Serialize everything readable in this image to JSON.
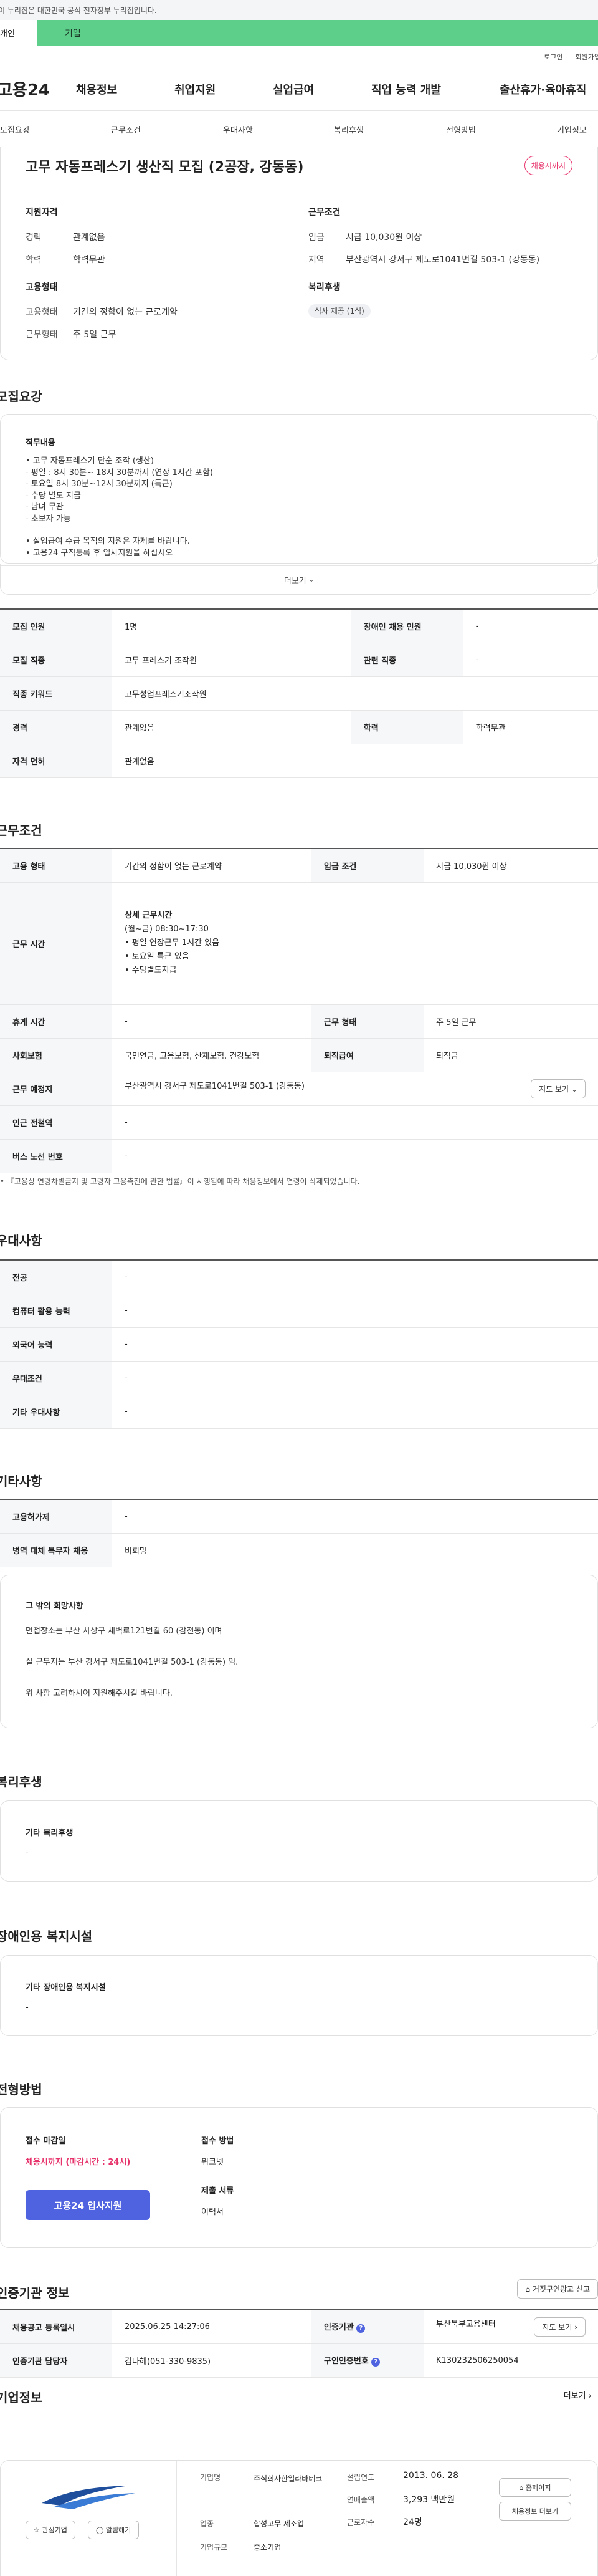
{
  "gov_bar": "이 누리집은 대한민국 공식 전자정부 누리집입니다.",
  "tabs": {
    "left": "개인",
    "right": "기업"
  },
  "util": {
    "login": "로그인",
    "join": "회원가입"
  },
  "gnb": {
    "logo": "고용24",
    "items": [
      "채용정보",
      "취업지원",
      "실업급여",
      "직업 능력 개발",
      "출산휴가·육아휴직"
    ]
  },
  "subnav": [
    "모집요강",
    "근무조건",
    "우대사항",
    "복리후생",
    "전형방법",
    "기업정보"
  ],
  "summary": {
    "title": "고무 자동프레스기 생산직 모집 (2공장, 강동동)",
    "badge": "채용시까지",
    "qual": {
      "heading": "지원자격",
      "rows": [
        {
          "k": "경력",
          "v": "관계없음"
        },
        {
          "k": "학력",
          "v": "학력무관"
        }
      ]
    },
    "cond": {
      "heading": "근무조건",
      "rows": [
        {
          "k": "임금",
          "v": "시급 10,030원 이상"
        },
        {
          "k": "지역",
          "v": "부산광역시 강서구 제도로1041번길 503-1 (강동동)"
        }
      ]
    },
    "emp": {
      "heading": "고용형태",
      "rows": [
        {
          "k": "고용형태",
          "v": "기간의 정함이 없는 근로계약"
        },
        {
          "k": "근무형태",
          "v": "주 5일 근무"
        }
      ]
    },
    "welfare": {
      "heading": "복리후생",
      "chip": "식사 제공 (1식)"
    }
  },
  "recruit": {
    "title": "모집요강",
    "duty_heading": "직무내용",
    "duty_lines": [
      "• 고무 자동프레스기 단순 조작 (생산)",
      "- 평일 : 8시 30분~ 18시 30분까지 (연장 1시간 포함)",
      "- 토요일 8시 30분~12시 30분까지 (특근)",
      "- 수당 별도 지급",
      "- 남녀 무관",
      "- 초보자 가능",
      "",
      "• 실업급여 수급 목적의 지원은 자제를 바랍니다.",
      "• 고용24 구직등록 후 입사지원을 하십시오"
    ],
    "more": "더보기",
    "table": [
      {
        "k1": "모집 인원",
        "v1": "1명",
        "k2": "장애인 채용 인원",
        "v2": "-"
      },
      {
        "k1": "모집 직종",
        "v1": "고무 프레스기 조작원",
        "k2": "관련 직종",
        "v2": "-"
      },
      {
        "k1": "직종 키워드",
        "v1": "고무성업프레스기조작원"
      },
      {
        "k1": "경력",
        "v1": "관계없음",
        "k2": "학력",
        "v2": "학력무관"
      },
      {
        "k1": "자격 면허",
        "v1": "관계없음"
      }
    ]
  },
  "work": {
    "title": "근무조건",
    "emp_type_k": "고용 형태",
    "emp_type_v": "기간의 정함이 없는 근로계약",
    "wage_k": "임금 조건",
    "wage_v": "시급 10,030원 이상",
    "hours_k": "근무 시간",
    "hours_heading": "상세 근무시간",
    "hours_lines": [
      "(월~금) 08:30~17:30",
      "• 평일 연장근무 1시간 있음",
      "• 토요일 특근 있음",
      "• 수당별도지급"
    ],
    "rows": [
      {
        "k1": "휴게 시간",
        "v1": "-",
        "k2": "근무 형태",
        "v2": "주 5일 근무"
      },
      {
        "k1": "사회보험",
        "v1": "국민연금, 고용보험, 산재보험, 건강보험",
        "k2": "퇴직급여",
        "v2": "퇴직금"
      }
    ],
    "place_k": "근무 예정지",
    "place_v": "부산광역시 강서구 제도로1041번길 503-1 (강동동)",
    "map_btn": "지도 보기",
    "subway_k": "인근 전철역",
    "subway_v": "-",
    "bus_k": "버스 노선 번호",
    "bus_v": "-",
    "footnote": "『고용상 연령차별금지 및 고령자 고용촉진에 관한 법률』이 시행됨에 따라 채용정보에서 연령이 삭제되었습니다."
  },
  "pref": {
    "title": "우대사항",
    "rows": [
      {
        "k": "전공",
        "v": "-"
      },
      {
        "k": "컴퓨터 활용 능력",
        "v": "-"
      },
      {
        "k": "외국어 능력",
        "v": "-"
      },
      {
        "k": "우대조건",
        "v": "-"
      },
      {
        "k": "기타 우대사항",
        "v": "-"
      }
    ]
  },
  "etc": {
    "title": "기타사항",
    "rows": [
      {
        "k": "고용허가제",
        "v": "-"
      },
      {
        "k": "병역 대체 복무자 채용",
        "v": "비희망"
      }
    ],
    "box_heading": "그 밖의 희망사항",
    "box_lines": [
      "면접장소는 부산 사상구 새벽로121번길 60 (감전동) 이며",
      "실 근무지는 부산 강서구 제도로1041번길 503-1 (강동동) 임.",
      "위 사항 고려하시어 지원해주시길 바랍니다."
    ]
  },
  "welfare": {
    "title": "복리후생",
    "heading": "기타 복리후생",
    "value": "-"
  },
  "disab": {
    "title": "장애인용 복지시설",
    "heading": "기타 장애인용 복지시설",
    "value": "-"
  },
  "screen": {
    "title": "전형방법",
    "deadline_h": "접수 마감일",
    "deadline_v": "채용시까지 (마감시간 : 24시)",
    "apply_btn": "고용24 입사지원",
    "method_h": "접수 방법",
    "method_v": "워크넷",
    "docs_h": "제출 서류",
    "docs_v": "이력서"
  },
  "cert": {
    "title": "인증기관 정보",
    "report_btn": "거짓구인광고 신고",
    "reg_k": "채용공고 등록일시",
    "reg_v": "2025.06.25 14:27:06",
    "org_k": "인증기관",
    "org_v": "부산북부고용센터",
    "map_btn": "지도 보기",
    "mgr_k": "인증기관 담당자",
    "mgr_v": "김다혜(051-330-9835)",
    "id_k": "구인인증번호",
    "id_v": "K130232506250054"
  },
  "company": {
    "title": "기업정보",
    "more": "더보기",
    "name_k": "기업명",
    "name_v": "주식회사한일라바테크",
    "ind_k": "업종",
    "ind_v": "합성고무 제조업",
    "size_k": "기업규모",
    "size_v": "중소기업",
    "est_k": "설립연도",
    "est_v": "2013. 06. 28",
    "rev_k": "연매출액",
    "rev_v": "3,293 백만원",
    "emp_k": "근로자수",
    "emp_v": "24명",
    "btn_home": "홈페이지",
    "btn_more": "채용정보 더보기",
    "btn_fav": "관심기업",
    "btn_follow": "알림해기"
  }
}
